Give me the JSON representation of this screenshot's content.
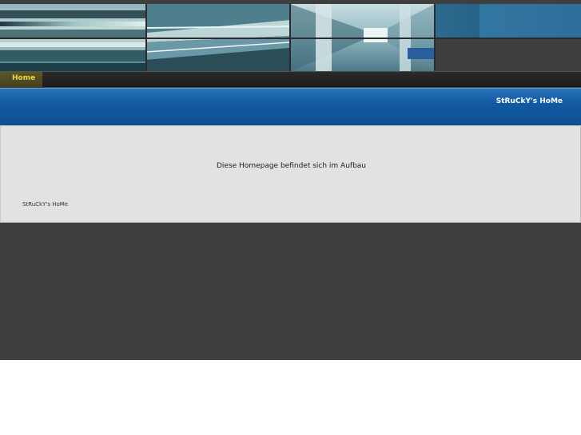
{
  "nav": {
    "items": [
      {
        "label": "Home",
        "active": true
      }
    ]
  },
  "header": {
    "site_title": "StRuCkY's HoMe"
  },
  "main": {
    "message": "Diese Homepage befindet sich im Aufbau",
    "footer": "StRuCkY's HoMe"
  },
  "colors": {
    "page_background": "#3f3f3f",
    "title_bar_blue": "#125aa3",
    "content_background": "#e2e2e2",
    "nav_active_text": "#e8d84a"
  }
}
